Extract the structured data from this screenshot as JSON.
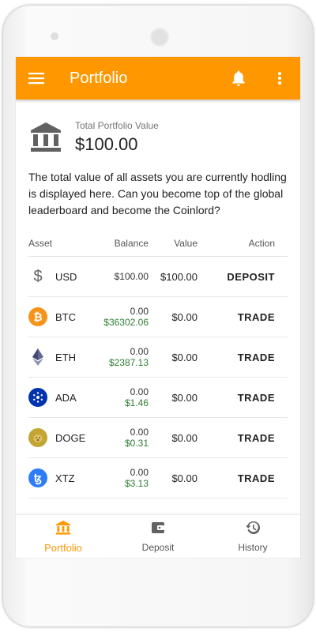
{
  "appbar": {
    "title": "Portfolio"
  },
  "summary": {
    "label": "Total Portfolio Value",
    "value": "$100.00"
  },
  "description": "The total value of all assets you are currently hodling is displayed here. Can you become top of the global leaderboard and become the Coinlord?",
  "table": {
    "headers": {
      "asset": "Asset",
      "balance": "Balance",
      "value": "Value",
      "action": "Action"
    },
    "rows": [
      {
        "asset": "USD",
        "icon": "dollar-icon",
        "balance": "$100.00",
        "price": "",
        "value": "$100.00",
        "action": "DEPOSIT"
      },
      {
        "asset": "BTC",
        "icon": "bitcoin-icon",
        "balance": "0.00",
        "price": "$36302.06",
        "value": "$0.00",
        "action": "TRADE"
      },
      {
        "asset": "ETH",
        "icon": "ethereum-icon",
        "balance": "0.00",
        "price": "$2387.13",
        "value": "$0.00",
        "action": "TRADE"
      },
      {
        "asset": "ADA",
        "icon": "cardano-icon",
        "balance": "0.00",
        "price": "$1.46",
        "value": "$0.00",
        "action": "TRADE"
      },
      {
        "asset": "DOGE",
        "icon": "dogecoin-icon",
        "balance": "0.00",
        "price": "$0.31",
        "value": "$0.00",
        "action": "TRADE"
      },
      {
        "asset": "XTZ",
        "icon": "tezos-icon",
        "balance": "0.00",
        "price": "$3.13",
        "value": "$0.00",
        "action": "TRADE"
      }
    ]
  },
  "nav": {
    "portfolio": "Portfolio",
    "deposit": "Deposit",
    "history": "History"
  },
  "colors": {
    "accent": "#ff9800",
    "price": "#2e7d32"
  }
}
